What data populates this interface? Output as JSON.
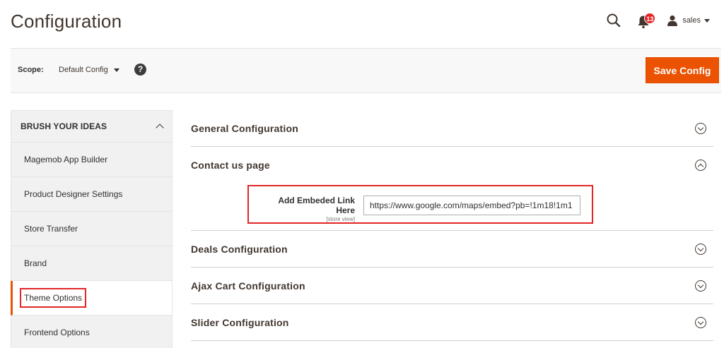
{
  "header": {
    "title": "Configuration",
    "notification_count": "13",
    "user_name": "sales"
  },
  "scope": {
    "label": "Scope:",
    "value": "Default Config",
    "help_icon": "?",
    "save_label": "Save Config"
  },
  "sidebar": {
    "title": "BRUSH YOUR IDEAS",
    "items": [
      {
        "label": "Magemob App Builder"
      },
      {
        "label": "Product Designer Settings"
      },
      {
        "label": "Store Transfer"
      },
      {
        "label": "Brand"
      },
      {
        "label": "Theme Options"
      },
      {
        "label": "Frontend Options"
      }
    ]
  },
  "sections": [
    {
      "title": "General Configuration"
    },
    {
      "title": "Contact us page"
    },
    {
      "title": "Deals Configuration"
    },
    {
      "title": "Ajax Cart Configuration"
    },
    {
      "title": "Slider Configuration"
    }
  ],
  "contact_field": {
    "label": "Add Embeded Link Here",
    "scope": "[store view]",
    "value": "https://www.google.com/maps/embed?pb=!1m18!1m1"
  },
  "colors": {
    "accent": "#eb5202",
    "highlight": "#e22626"
  }
}
